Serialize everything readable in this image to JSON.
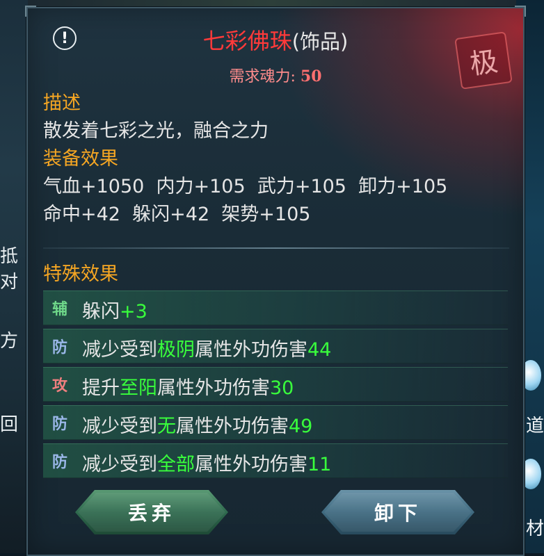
{
  "background": {
    "left_fragments": [
      "抵对",
      "方",
      "回"
    ],
    "right_fragments": [
      "道",
      "材"
    ]
  },
  "item": {
    "name": "七彩佛珠",
    "category": "(饰品)",
    "grade_seal": "极",
    "name_color": "#ff3a3a",
    "info_icon": "exclamation-icon"
  },
  "requirement": {
    "label": "需求魂力:",
    "value": "50"
  },
  "description": {
    "heading": "描述",
    "text": "散发着七彩之光，融合之力"
  },
  "equip_effects": {
    "heading": "装备效果",
    "lines": [
      "气血+1050  内力+105  武力+105  卸力+105",
      "命中+42  躲闪+42  架势+105"
    ]
  },
  "special_effects": {
    "heading": "特殊效果",
    "rows": [
      {
        "tag": "辅",
        "prefix": "躲闪",
        "highlight": "",
        "middle": "",
        "value": "+3"
      },
      {
        "tag": "防",
        "prefix": "减少受到",
        "highlight": "极阴",
        "middle": "属性外功伤害",
        "value": "44"
      },
      {
        "tag": "攻",
        "prefix": "提升",
        "highlight": "至阳",
        "middle": "属性外功伤害",
        "value": "30"
      },
      {
        "tag": "防",
        "prefix": "减少受到",
        "highlight": "无",
        "middle": "属性外功伤害",
        "value": "49"
      },
      {
        "tag": "防",
        "prefix": "减少受到",
        "highlight": "全部",
        "middle": "属性外功伤害",
        "value": "11"
      }
    ]
  },
  "buttons": {
    "discard": "丢弃",
    "unequip": "卸下"
  },
  "colors": {
    "heading": "#f5a623",
    "highlight": "#39ff3c",
    "requirement": "#ff8c8c"
  }
}
